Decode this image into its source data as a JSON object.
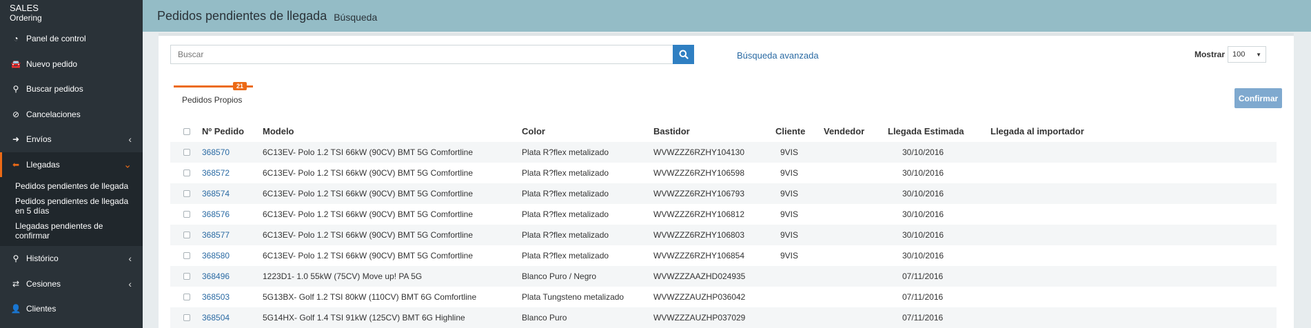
{
  "app": {
    "name": "SALES",
    "module": "Ordering"
  },
  "sidebar": {
    "items": [
      {
        "label": "Panel de control",
        "icon": "dashboard-icon",
        "glyph": "◔"
      },
      {
        "label": "Nuevo pedido",
        "icon": "car-icon",
        "glyph": "🚘"
      },
      {
        "label": "Buscar pedidos",
        "icon": "search-icon",
        "glyph": "⚲"
      },
      {
        "label": "Cancelaciones",
        "icon": "ban-icon",
        "glyph": "⊘"
      },
      {
        "label": "Envíos",
        "icon": "arrow-right-icon",
        "glyph": "➜"
      },
      {
        "label": "Llegadas",
        "icon": "arrow-left-icon",
        "glyph": "⬅"
      },
      {
        "label": "Histórico",
        "icon": "search-icon",
        "glyph": "⚲"
      },
      {
        "label": "Cesiones",
        "icon": "exchange-icon",
        "glyph": "⇄"
      },
      {
        "label": "Clientes",
        "icon": "user-icon",
        "glyph": "👤"
      }
    ],
    "submenu": [
      "Pedidos pendientes de llegada",
      "Pedidos pendientes de llegada en 5 días",
      "Llegadas pendientes de confirmar"
    ]
  },
  "header": {
    "title": "Pedidos pendientes de llegada",
    "subtitle": "Búsqueda"
  },
  "search": {
    "placeholder": "Buscar",
    "advanced_label": "Búsqueda avanzada"
  },
  "show": {
    "label": "Mostrar",
    "value": "100"
  },
  "tab": {
    "label": "Pedidos Propios",
    "badge": "21"
  },
  "confirm_label": "Confirmar",
  "table": {
    "columns": [
      "Nº Pedido",
      "Modelo",
      "Color",
      "Bastidor",
      "Cliente",
      "Vendedor",
      "Llegada Estimada",
      "Llegada al importador"
    ],
    "rows": [
      [
        "368570",
        "6C13EV- Polo 1.2 TSI 66kW (90CV) BMT 5G Comfortline",
        "Plata R?flex metalizado",
        "WVWZZZ6RZHY104130",
        "9VIS",
        "",
        "30/10/2016",
        ""
      ],
      [
        "368572",
        "6C13EV- Polo 1.2 TSI 66kW (90CV) BMT 5G Comfortline",
        "Plata R?flex metalizado",
        "WVWZZZ6RZHY106598",
        "9VIS",
        "",
        "30/10/2016",
        ""
      ],
      [
        "368574",
        "6C13EV- Polo 1.2 TSI 66kW (90CV) BMT 5G Comfortline",
        "Plata R?flex metalizado",
        "WVWZZZ6RZHY106793",
        "9VIS",
        "",
        "30/10/2016",
        ""
      ],
      [
        "368576",
        "6C13EV- Polo 1.2 TSI 66kW (90CV) BMT 5G Comfortline",
        "Plata R?flex metalizado",
        "WVWZZZ6RZHY106812",
        "9VIS",
        "",
        "30/10/2016",
        ""
      ],
      [
        "368577",
        "6C13EV- Polo 1.2 TSI 66kW (90CV) BMT 5G Comfortline",
        "Plata R?flex metalizado",
        "WVWZZZ6RZHY106803",
        "9VIS",
        "",
        "30/10/2016",
        ""
      ],
      [
        "368580",
        "6C13EV- Polo 1.2 TSI 66kW (90CV) BMT 5G Comfortline",
        "Plata R?flex metalizado",
        "WVWZZZ6RZHY106854",
        "9VIS",
        "",
        "30/10/2016",
        ""
      ],
      [
        "368496",
        "1223D1- 1.0 55kW (75CV) Move up! PA 5G",
        "Blanco Puro / Negro",
        "WVWZZZAAZHD024935",
        "",
        "",
        "07/11/2016",
        ""
      ],
      [
        "368503",
        "5G13BX- Golf 1.2 TSI 80kW (110CV) BMT 6G Comfortline",
        "Plata Tungsteno metalizado",
        "WVWZZZAUZHP036042",
        "",
        "",
        "07/11/2016",
        ""
      ],
      [
        "368504",
        "5G14HX- Golf 1.4 TSI 91kW (125CV) BMT 6G Highline",
        "Blanco Puro",
        "WVWZZZAUZHP037029",
        "",
        "",
        "07/11/2016",
        ""
      ]
    ]
  },
  "colors": {
    "sidebar": "#2a3238",
    "accent": "#ec6a16",
    "header": "#94bcc6",
    "link": "#2a6aa3",
    "primary": "#2f7fc2"
  }
}
